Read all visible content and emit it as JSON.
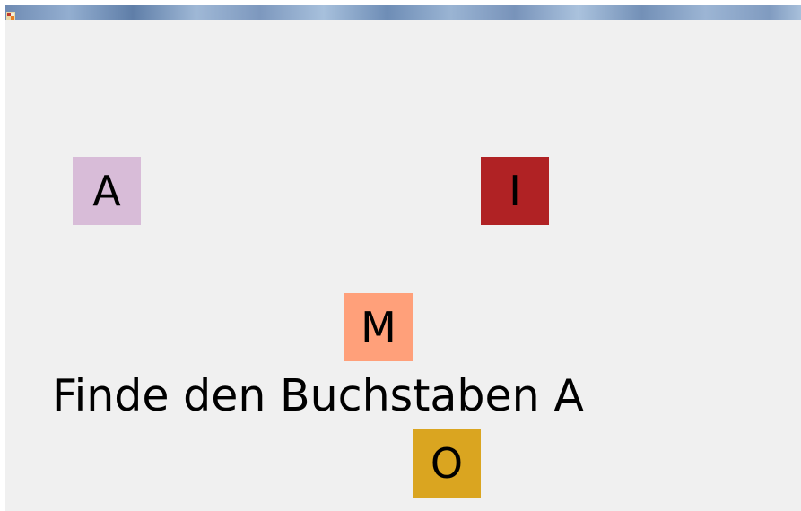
{
  "window": {
    "icon": "app-icon"
  },
  "game": {
    "prompt": "Finde den Buchstaben A",
    "tiles": [
      {
        "letter": "A",
        "color": "#d8bcd8"
      },
      {
        "letter": "I",
        "color": "#b02224"
      },
      {
        "letter": "M",
        "color": "#ffa07a"
      },
      {
        "letter": "O",
        "color": "#daa520"
      }
    ]
  }
}
